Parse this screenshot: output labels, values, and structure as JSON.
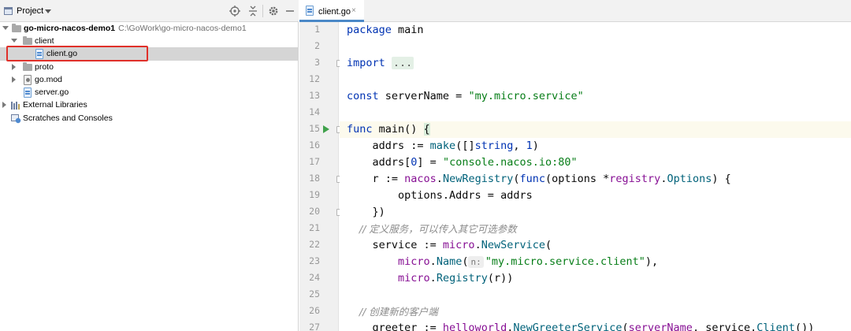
{
  "project_panel": {
    "title": "Project",
    "tree": [
      {
        "label": "go-micro-nacos-demo1",
        "path": "C:\\GoWork\\go-micro-nacos-demo1"
      },
      {
        "label": "client"
      },
      {
        "label": "client.go"
      },
      {
        "label": "proto"
      },
      {
        "label": "go.mod"
      },
      {
        "label": "server.go"
      },
      {
        "label": "External Libraries"
      },
      {
        "label": "Scratches and Consoles"
      }
    ]
  },
  "editor": {
    "tab": {
      "label": "client.go",
      "close": "×"
    },
    "line_numbers": [
      "1",
      "2",
      "3",
      "12",
      "13",
      "14",
      "15",
      "16",
      "17",
      "18",
      "19",
      "20",
      "21",
      "22",
      "23",
      "24",
      "25",
      "26",
      "27"
    ],
    "code": {
      "l1_kw": "package",
      "l1_name": " main",
      "l3_kw": "import",
      "l3_fold": "...",
      "l13_kw": "const",
      "l13_name": " serverName = ",
      "l13_str": "\"my.micro.service\"",
      "l15_kw": "func",
      "l15_name": " main() ",
      "l15_brace": "{",
      "l16_a": "    addrs := ",
      "l16_fn": "make",
      "l16_b": "([]",
      "l16_kw": "string",
      "l16_c": ", ",
      "l16_num": "1",
      "l16_d": ")",
      "l17_a": "    addrs[",
      "l17_num": "0",
      "l17_b": "] = ",
      "l17_str": "\"console.nacos.io:80\"",
      "l18_a": "    r := ",
      "l18_pkg": "nacos",
      "l18_b": ".",
      "l18_fn": "NewRegistry",
      "l18_c": "(",
      "l18_kw": "func",
      "l18_d": "(options *",
      "l18_pkg2": "registry",
      "l18_e": ".",
      "l18_fn2": "Options",
      "l18_f": ") {",
      "l19": "        options.Addrs = addrs",
      "l20": "    })",
      "l21_cmt": "    // 定义服务，可以传入其它可选参数",
      "l22_a": "    service := ",
      "l22_pkg": "micro",
      "l22_b": ".",
      "l22_fn": "NewService",
      "l22_c": "(",
      "l23_a": "        ",
      "l23_pkg": "micro",
      "l23_b": ".",
      "l23_fn": "Name",
      "l23_c": "(",
      "l23_hint": "n:",
      "l23_str": "\"my.micro.service.client\"",
      "l23_d": "),",
      "l24_a": "        ",
      "l24_pkg": "micro",
      "l24_b": ".",
      "l24_fn": "Registry",
      "l24_c": "(r))",
      "l26_cmt": "    // 创建新的客户端",
      "l27_a": "    greeter := ",
      "l27_pkg": "helloworld",
      "l27_b": ".",
      "l27_fn": "NewGreeterService",
      "l27_c": "(",
      "l27_d": "serverName",
      "l27_e": ", service.",
      "l27_fn2": "Client",
      "l27_f": "())"
    }
  },
  "colors": {
    "keyword": "#0033b3",
    "string": "#067d17",
    "function": "#00627a",
    "package": "#871094",
    "comment": "#8c8c8c",
    "highlight_box": "#e0302a",
    "run_icon": "#3fa14b"
  },
  "icons": [
    "project-icon",
    "dropdown-icon",
    "locate-icon",
    "collapse-icon",
    "gear-icon",
    "minimize-icon",
    "folder-icon",
    "go-file-icon",
    "go-mod-icon",
    "library-icon",
    "scratch-icon",
    "run-icon",
    "fold-icon"
  ]
}
